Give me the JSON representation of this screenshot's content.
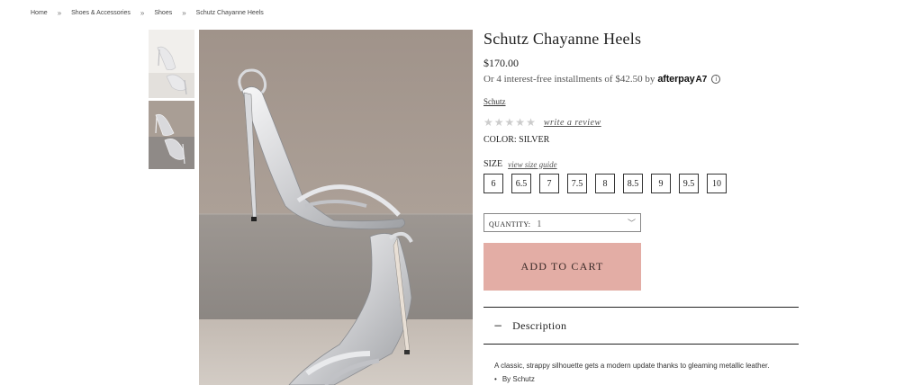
{
  "breadcrumb": [
    "Home",
    "Shoes & Accessories",
    "Shoes",
    "Schutz Chayanne Heels"
  ],
  "breadcrumb_separator": "»",
  "product": {
    "title": "Schutz Chayanne Heels",
    "price": "$170.00",
    "installments_text": "Or 4 interest-free installments of $42.50 by",
    "afterpay_logo": "afterpay",
    "afterpay_mark": "A7",
    "info_glyph": "i",
    "brand": "Schutz",
    "rating": 0,
    "rating_max": 5,
    "write_review": "write a review",
    "color_label": "COLOR: SILVER",
    "size_label": "SIZE",
    "size_guide": "view size guide",
    "sizes": [
      "6",
      "6.5",
      "7",
      "7.5",
      "8",
      "8.5",
      "9",
      "9.5",
      "10"
    ],
    "quantity_label": "QUANTITY:",
    "quantity_value": "1",
    "add_to_cart": "ADD TO CART",
    "description_title": "Description",
    "description_text": "A classic, strappy silhouette gets a modern update thanks to gleaming metallic leather.",
    "description_bullets": [
      "By Schutz"
    ]
  },
  "icons": {
    "star": "star-icon",
    "chevron": "chevron-down-icon",
    "minus": "minus-icon",
    "info": "info-icon"
  },
  "colors": {
    "add_to_cart_bg": "#e3ada5",
    "star_empty": "#cccccc"
  }
}
